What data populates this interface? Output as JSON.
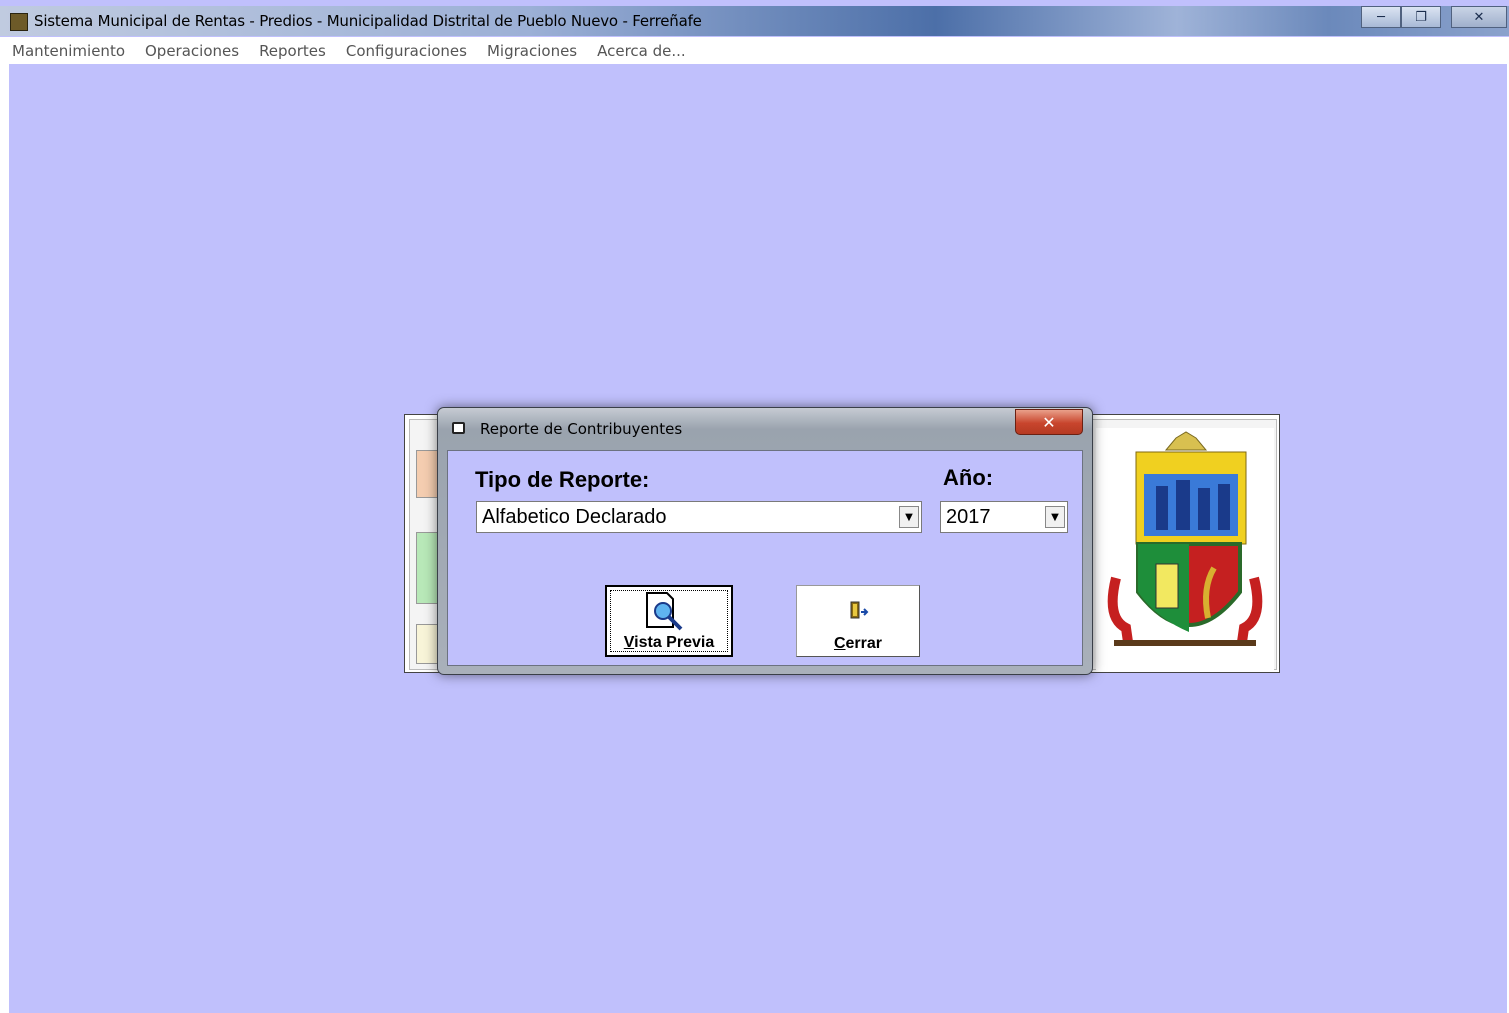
{
  "window": {
    "title": "Sistema Municipal de Rentas - Predios - Municipalidad Distrital de Pueblo Nuevo - Ferreñafe",
    "app_icon": "app-icon",
    "controls": [
      "minimize-icon",
      "restore-icon",
      "close-icon"
    ]
  },
  "menubar": {
    "items": [
      {
        "label": "Mantenimiento"
      },
      {
        "label": "Operaciones"
      },
      {
        "label": "Reportes"
      },
      {
        "label": "Configuraciones"
      },
      {
        "label": "Migraciones"
      },
      {
        "label": "Acerca de..."
      }
    ]
  },
  "dialog": {
    "title": "Reporte de Contribuyentes",
    "tipo_label": "Tipo de Reporte:",
    "tipo_value": "Alfabetico Declarado",
    "anio_label": "Año:",
    "anio_value": "2017",
    "preview_button": {
      "prefix": "V",
      "rest": "ista Previa"
    },
    "close_button": {
      "prefix": "C",
      "rest": "errar"
    }
  },
  "colors": {
    "workspace": "#c0c0fc",
    "close_button": "#c8452d"
  }
}
